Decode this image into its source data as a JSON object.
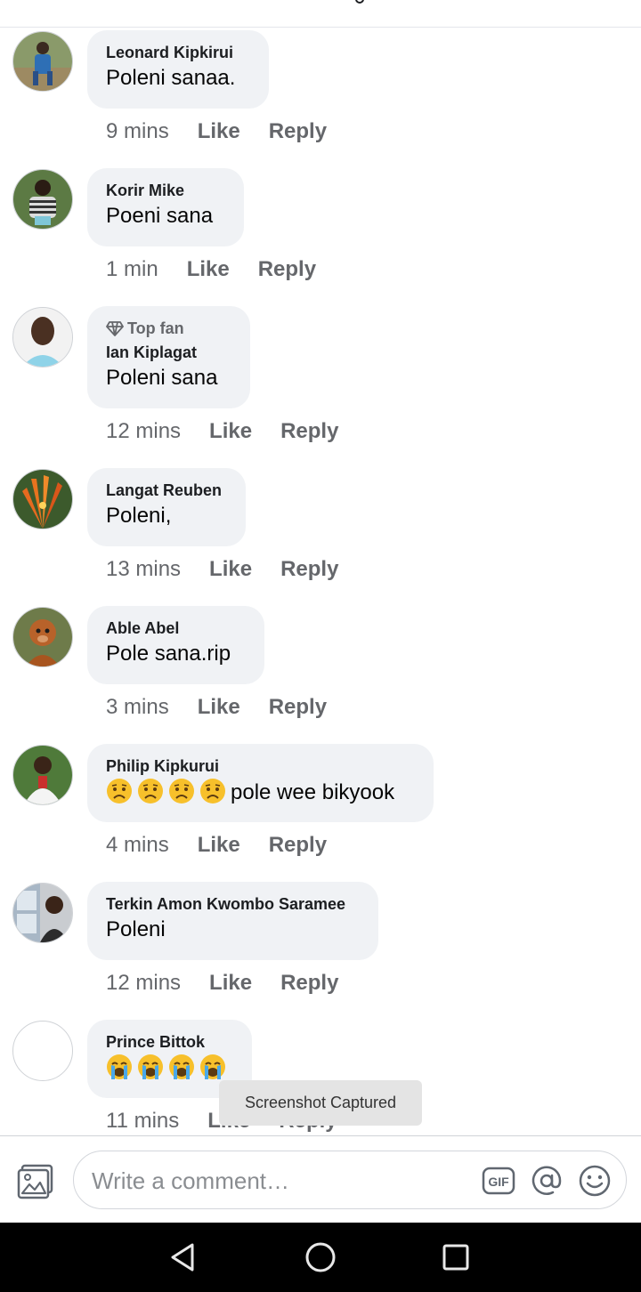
{
  "comments": [
    {
      "author": "Leonard Kipkirui",
      "text": "Poleni sanaa.",
      "time": "9 mins",
      "like": "Like",
      "reply": "Reply"
    },
    {
      "author": "Korir Mike",
      "text": "Poeni sana",
      "time": "1 min",
      "like": "Like",
      "reply": "Reply"
    },
    {
      "badge": "Top fan",
      "author": "Ian Kiplagat",
      "text": "Poleni sana",
      "time": "12 mins",
      "like": "Like",
      "reply": "Reply"
    },
    {
      "author": "Langat Reuben",
      "text": "Poleni,",
      "time": "13 mins",
      "like": "Like",
      "reply": "Reply"
    },
    {
      "author": "Able Abel",
      "text": "Pole sana.rip",
      "time": "3 mins",
      "like": "Like",
      "reply": "Reply"
    },
    {
      "author": "Philip Kipkurui",
      "text": "pole wee bikyook",
      "time": "4 mins",
      "like": "Like",
      "reply": "Reply",
      "emoji": "sad-face"
    },
    {
      "author": "Terkin Amon Kwombo Saramee",
      "text": "Poleni",
      "time": "12 mins",
      "like": "Like",
      "reply": "Reply"
    },
    {
      "author": "Prince Bittok",
      "text": "",
      "time": "11 mins",
      "like": "Like",
      "reply": "Reply",
      "emoji": "crying-face"
    }
  ],
  "toast": "Screenshot Captured",
  "composer": {
    "placeholder": "Write a comment…",
    "icons": [
      "photo-icon",
      "gif-icon",
      "mention-icon",
      "emoji-icon"
    ]
  },
  "nav": {
    "icons": [
      "back-icon",
      "home-icon",
      "recents-icon"
    ]
  },
  "colors": {
    "bubble": "#f0f2f5",
    "meta": "#65676b",
    "text": "#050505",
    "nav": "#000000"
  }
}
